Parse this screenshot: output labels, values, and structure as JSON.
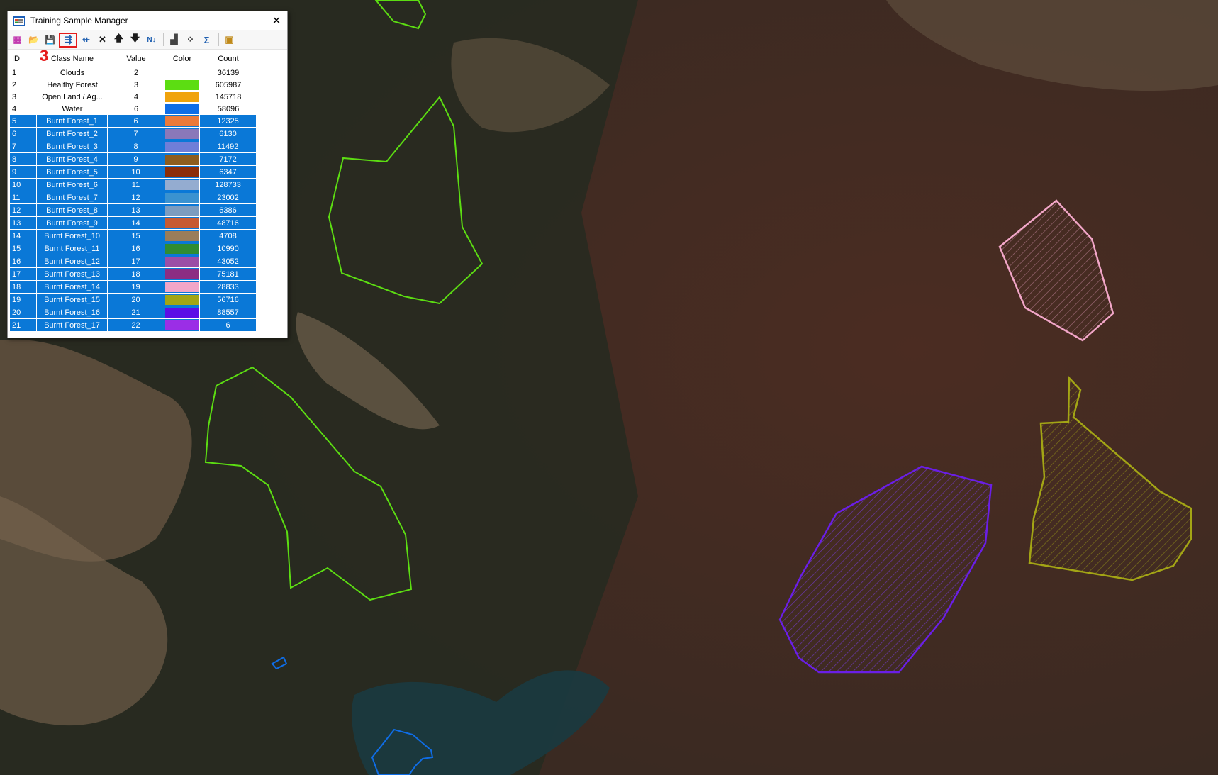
{
  "window": {
    "title": "Training Sample Manager",
    "close_glyph": "✕",
    "annotation_number": "3"
  },
  "toolbar": [
    {
      "name": "create-new-schema-icon",
      "glyph": "▦"
    },
    {
      "name": "open-folder-icon",
      "glyph": "📂"
    },
    {
      "name": "save-icon",
      "glyph": "💾"
    },
    {
      "name": "merge-icon",
      "glyph": "⇶",
      "highlighted": true
    },
    {
      "name": "split-icon",
      "glyph": "⇷"
    },
    {
      "name": "delete-icon",
      "glyph": "✕"
    },
    {
      "name": "move-up-icon",
      "glyph": "🡅"
    },
    {
      "name": "move-down-icon",
      "glyph": "🡇"
    },
    {
      "name": "reset-order-icon",
      "glyph": "N↓"
    },
    {
      "name": "histogram-icon",
      "glyph": "▟"
    },
    {
      "name": "scatterplot-icon",
      "glyph": "⁘"
    },
    {
      "name": "statistics-icon",
      "glyph": "Σ"
    },
    {
      "name": "evaluate-icon",
      "glyph": "▣"
    }
  ],
  "columns": {
    "id": "ID",
    "name": "Class Name",
    "value": "Value",
    "color": "Color",
    "count": "Count"
  },
  "rows": [
    {
      "id": "1",
      "name": "Clouds",
      "value": "2",
      "color": "#ffffff",
      "count": "36139",
      "selected": false
    },
    {
      "id": "2",
      "name": "Healthy Forest",
      "value": "3",
      "color": "#5cdd12",
      "count": "605987",
      "selected": false
    },
    {
      "id": "3",
      "name": "Open Land / Ag...",
      "value": "4",
      "color": "#f0a30c",
      "count": "145718",
      "selected": false
    },
    {
      "id": "4",
      "name": "Water",
      "value": "6",
      "color": "#0f6de6",
      "count": "58096",
      "selected": false
    },
    {
      "id": "5",
      "name": "Burnt Forest_1",
      "value": "6",
      "color": "#ec7a3a",
      "count": "12325",
      "selected": true
    },
    {
      "id": "6",
      "name": "Burnt Forest_2",
      "value": "7",
      "color": "#8a78b9",
      "count": "6130",
      "selected": true
    },
    {
      "id": "7",
      "name": "Burnt Forest_3",
      "value": "8",
      "color": "#6f7ed8",
      "count": "11492",
      "selected": true
    },
    {
      "id": "8",
      "name": "Burnt Forest_4",
      "value": "9",
      "color": "#8d5d1e",
      "count": "7172",
      "selected": true
    },
    {
      "id": "9",
      "name": "Burnt Forest_5",
      "value": "10",
      "color": "#8b2d08",
      "count": "6347",
      "selected": true
    },
    {
      "id": "10",
      "name": "Burnt Forest_6",
      "value": "11",
      "color": "#94acd0",
      "count": "128733",
      "selected": true
    },
    {
      "id": "11",
      "name": "Burnt Forest_7",
      "value": "12",
      "color": "#3a92d0",
      "count": "23002",
      "selected": true
    },
    {
      "id": "12",
      "name": "Burnt Forest_8",
      "value": "13",
      "color": "#7c9cbf",
      "count": "6386",
      "selected": true
    },
    {
      "id": "13",
      "name": "Burnt Forest_9",
      "value": "14",
      "color": "#c65a32",
      "count": "48716",
      "selected": true
    },
    {
      "id": "14",
      "name": "Burnt Forest_10",
      "value": "15",
      "color": "#9a7d5a",
      "count": "4708",
      "selected": true
    },
    {
      "id": "15",
      "name": "Burnt Forest_11",
      "value": "16",
      "color": "#2f8c32",
      "count": "10990",
      "selected": true
    },
    {
      "id": "16",
      "name": "Burnt Forest_12",
      "value": "17",
      "color": "#9b4ea6",
      "count": "43052",
      "selected": true
    },
    {
      "id": "17",
      "name": "Burnt Forest_13",
      "value": "18",
      "color": "#8c2d83",
      "count": "75181",
      "selected": true
    },
    {
      "id": "18",
      "name": "Burnt Forest_14",
      "value": "19",
      "color": "#f2a6c8",
      "count": "28833",
      "selected": true
    },
    {
      "id": "19",
      "name": "Burnt Forest_15",
      "value": "20",
      "color": "#a3a515",
      "count": "56716",
      "selected": true
    },
    {
      "id": "20",
      "name": "Burnt Forest_16",
      "value": "21",
      "color": "#5b0ee6",
      "count": "88557",
      "selected": true
    },
    {
      "id": "21",
      "name": "Burnt Forest_17",
      "value": "22",
      "color": "#9b2ee6",
      "count": "6",
      "selected": true
    }
  ],
  "map_polygons": [
    {
      "class": "Healthy Forest",
      "color": "#5cdd12",
      "fill": false
    },
    {
      "class": "Water",
      "color": "#0f6de6",
      "fill": false
    },
    {
      "class": "Burnt Forest_14",
      "color": "#f2a6c8",
      "fill": true
    },
    {
      "class": "Burnt Forest_15",
      "color": "#a3a515",
      "fill": true
    },
    {
      "class": "Burnt Forest_16",
      "color": "#5b0ee6",
      "fill": true
    }
  ]
}
